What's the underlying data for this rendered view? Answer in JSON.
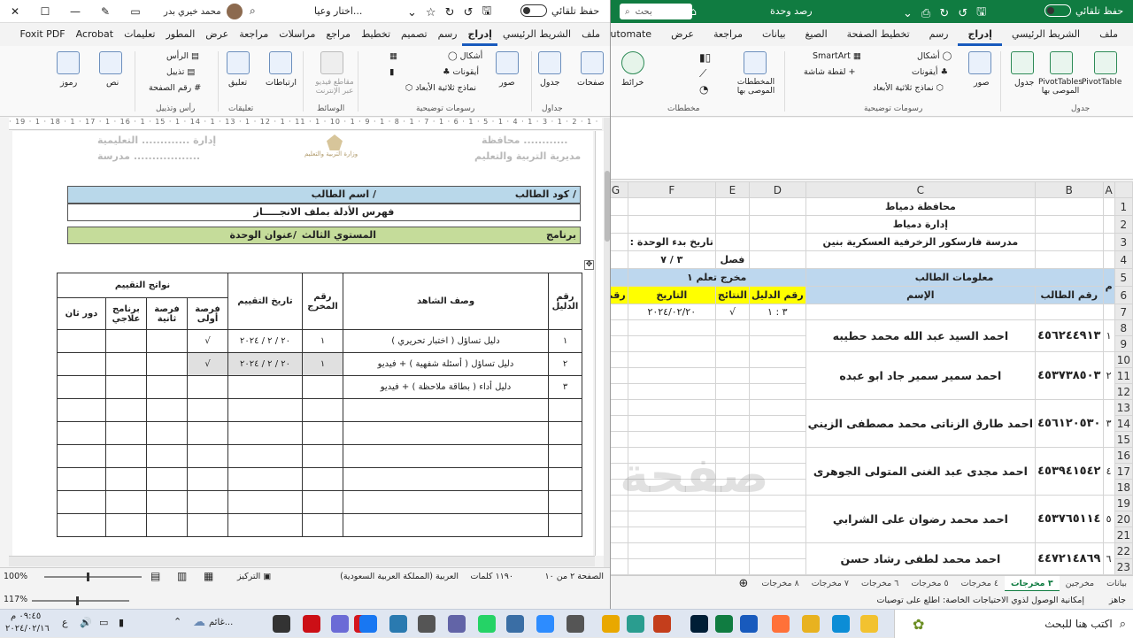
{
  "word": {
    "title": {
      "document": "اختار وعيا...",
      "user": "محمد خيري بدر",
      "autosave_label": "حفظ تلقائي"
    },
    "tabs": [
      "ملف",
      "الشريط الرئيسي",
      "إدراج",
      "رسم",
      "تصميم",
      "تخطيط",
      "مراجع",
      "مراسلات",
      "مراجعة",
      "عرض",
      "المطور",
      "تعليمات",
      "Acrobat",
      "Foxit PDF"
    ],
    "active_tab": "إدراج",
    "ribbon": {
      "pages": "صفحات",
      "table": "جدول",
      "pictures": "صور",
      "shapes": "أشكال",
      "icons": "أيقونات",
      "models_3d": "نماذج ثلاثية الأبعاد",
      "video": "مقاطع فيديو عبر الإنترنت",
      "links": "ارتباطات",
      "comment": "تعليق",
      "header": "الرأس",
      "footer": "تذييل",
      "page_number": "رقم الصفحة",
      "text": "نص",
      "symbols": "رموز",
      "groups": [
        "جداول",
        "رسومات توضيحية",
        "الوسائط",
        "تعليقات",
        "رأس وتذييل"
      ]
    },
    "ruler": "· 19 · 1 · 18 · 1 · 17 · 1 · 16 · 1 · 15 · 1 · 14 · 1 · 13 · 1 · 12 · 1 · 11 · 1 · 10 · 1 · 9 · 1 · 8 · 1 · 7 · 1 · 6 · 1 · 5 · 1 · 4 · 1 · 3 · 1 · 2 · 1 · 1 · 1 ·",
    "doc": {
      "header_right_1": "محافظة ............",
      "header_right_2": "مديرية التربية والتعليم",
      "header_left_1": "إدارة ............. التعليمية",
      "header_left_2": "مدرسة ..................",
      "ministry": "وزارة التربية والتعليم",
      "student_code": "كود الطالب /",
      "student_name": "اسم الطالب /",
      "index_title": "فهرس الأدلة بملف الانجـــــاز",
      "program": "برنامج",
      "level": "المستوي الثالث",
      "unit_title": "عنوان الوحدة/",
      "table_headers": {
        "evidence_no": "رقم الدليل",
        "description": "وصف الشاهد",
        "output_no": "رقم المخرج",
        "eval_date": "تاريخ التقييم",
        "eval_results": "نواتج التقييم",
        "first": "فرصة أولى",
        "second": "فرصة ثانية",
        "remedial": "برنامج علاجي",
        "round2": "دور ثان"
      },
      "rows": [
        {
          "no": "١",
          "desc": "دليل تساؤل ( اختبار تحريري )",
          "out": "١",
          "date": "٢٠ / ٢ / ٢٠٢٤",
          "first": "√"
        },
        {
          "no": "٢",
          "desc": "دليل تساؤل ( أسئلة شفهية ) + فيديو",
          "out": "١",
          "date": "٢٠ / ٢ / ٢٠٢٤",
          "first": "√"
        },
        {
          "no": "٣",
          "desc": "دليل أداء ( بطاقة ملاحظة ) + فيديو",
          "out": "",
          "date": "",
          "first": ""
        }
      ]
    },
    "status": {
      "page": "الصفحة ٢ من ١٠",
      "words": "١١٩٠ كلمات",
      "language": "العربية (المملكة العربية السعودية)",
      "focus": "التركيز",
      "zoom": "100%"
    }
  },
  "excel": {
    "title": {
      "autosave_label": "حفظ تلقائي",
      "document": "رصد وحدة",
      "search": "بحث"
    },
    "tabs": [
      "ملف",
      "الشريط الرئيسي",
      "إدراج",
      "رسم",
      "تخطيط الصفحة",
      "الصيغ",
      "بيانات",
      "مراجعة",
      "عرض",
      "Automate"
    ],
    "active_tab": "إدراج",
    "ribbon": {
      "pivot": "PivotTable",
      "pivot_rec": "PivotTables الموصى بها",
      "table": "جدول",
      "pictures": "صور",
      "shapes": "أشكال",
      "icons": "أيقونات",
      "models_3d": "نماذج ثلاثية الأبعاد",
      "smartart": "SmartArt",
      "screenshot": "لقطة شاشة",
      "rec_charts": "المخططات الموصى بها",
      "maps": "خرائط",
      "groups": [
        "جدول",
        "رسومات توضيحية",
        "مخططات"
      ]
    },
    "columns": [
      "A",
      "B",
      "C",
      "D",
      "E",
      "F",
      "G"
    ],
    "rows": [
      {
        "n": "1",
        "C": "محافظة دمياط"
      },
      {
        "n": "2",
        "C": "إدارة دمياط"
      },
      {
        "n": "3",
        "C": "مدرسة فارسكور الزخرفية العسكرية بنين",
        "F": "تاريخ بدء الوحدة :"
      },
      {
        "n": "4",
        "E": "فصل",
        "F": "٣ / ٧"
      },
      {
        "n": "5",
        "A": "م",
        "BC": "معلومات الطالب",
        "DEF": "مخرج تعلم ١"
      },
      {
        "n": "6",
        "B": "رقم الطالب",
        "C": "الإسم",
        "D": "رقم الدليل",
        "E": "النتائج",
        "F": "التاريخ",
        "G": "رقم"
      },
      {
        "n": "7",
        "D": "٣ : ١",
        "E": "√",
        "F": "٢٠٢٤/٠٢/٢٠"
      }
    ],
    "students": [
      {
        "m": "١",
        "id": "٤٥٦٢٤٤٩١٣",
        "name": "احمد السيد عبد الله محمد حطيبه",
        "rows": [
          "8",
          "9"
        ]
      },
      {
        "m": "٢",
        "id": "٤٥٣٧٣٨٥٠٣",
        "name": "احمد سمير سمير جاد ابو عبده",
        "rows": [
          "10",
          "11",
          "12"
        ]
      },
      {
        "m": "٣",
        "id": "٤٥٦١٢٠٥٣٠",
        "name": "احمد طارق الزناتى محمد مصطفى الزيني",
        "rows": [
          "13",
          "14",
          "15"
        ]
      },
      {
        "m": "٤",
        "id": "٤٥٣٩٤١٥٤٢",
        "name": "احمد مجدى عبد الغنى المتولى الجوهرى",
        "rows": [
          "16",
          "17",
          "18"
        ]
      },
      {
        "m": "٥",
        "id": "٤٥٣٧٦٥١١٤",
        "name": "احمد محمد رضوان على  الشرابي",
        "rows": [
          "19",
          "20",
          "21"
        ]
      },
      {
        "m": "٦",
        "id": "٤٤٧٢١٤٨٦٩",
        "name": "احمد محمد لطفى رشاد حسن",
        "rows": [
          "22",
          "23"
        ]
      }
    ],
    "watermark": "صفحة",
    "sheet_tabs": [
      "بيانات",
      "مخرجين",
      "٣ مخرجات",
      "٤ مخرجات",
      "٥ مخرجات",
      "٦ مخرجات",
      "٧ مخرجات",
      "٨ مخرجات"
    ],
    "active_sheet": "٣ مخرجات",
    "status": {
      "ready": "جاهز",
      "accessibility": "إمكانية الوصول لذوي الاحتياجات الخاصة: اطلع على توصيات",
      "zoom": "117%"
    }
  },
  "taskbar": {
    "search": "اكتب هنا للبحث",
    "weather": "غائم...",
    "time": "٠٩:٤٥ م",
    "date": "٢٠٢٤/٠٢/١٦",
    "lang": "ع",
    "colors": {
      "word": "#185abd",
      "excel": "#107c41",
      "edge": "#0c8dd6",
      "photoshop": "#001e36",
      "acrobat": "#d4161f",
      "powerpoint": "#c43e1c",
      "whatsapp": "#25d366",
      "chrome": "#e9a800",
      "facebook": "#1877f2",
      "zoom": "#2d8cff"
    }
  }
}
